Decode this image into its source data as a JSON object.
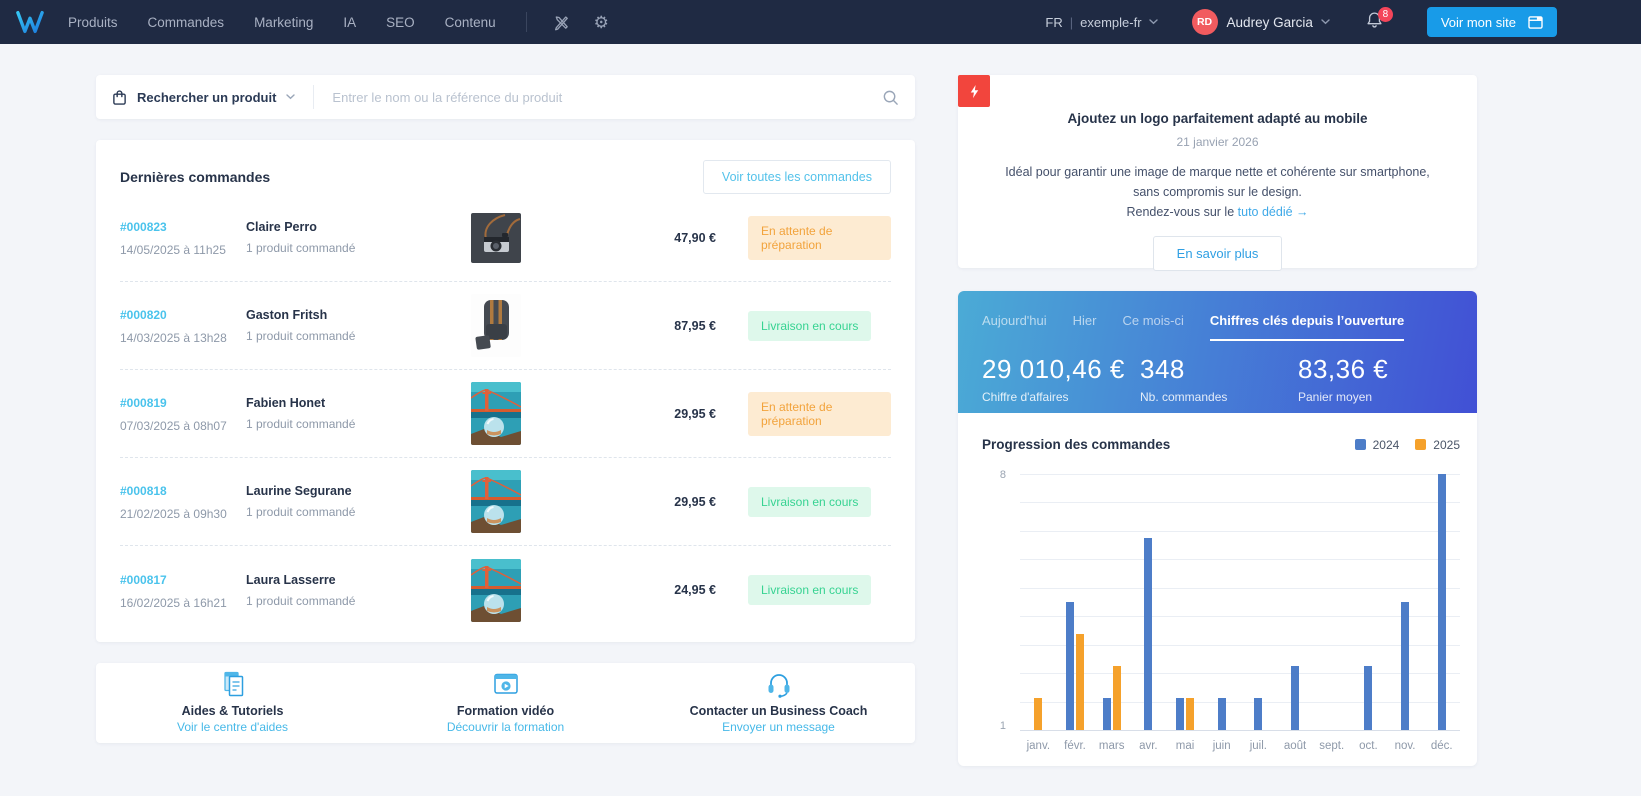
{
  "navbar": {
    "brand": "logo-w",
    "menu": [
      "Produits",
      "Commandes",
      "Marketing",
      "IA",
      "SEO",
      "Contenu"
    ],
    "icons": [
      "design-tools-icon",
      "settings-gear-icon"
    ],
    "locale": "FR",
    "site": "exemple-fr",
    "user_initials": "RD",
    "user_name": "Audrey Garcia",
    "notif_count": "8",
    "visit_site_label": "Voir mon site",
    "bg_color": "#1F2A43",
    "button_color": "#189BE8",
    "avatar_color": "#F15B5F"
  },
  "search": {
    "type_label": "Rechercher un produit",
    "placeholder": "Entrer le nom ou la référence du produit"
  },
  "orders": {
    "title": "Dernières commandes",
    "view_all_label": "Voir toutes les commandes",
    "rows": [
      {
        "id": "#000823",
        "date": "14/05/2025 à 11h25",
        "customer": "Claire Perro",
        "detail": "1 produit commandé",
        "thumb": "camera",
        "price": "47,90 €",
        "status": "En attente de préparation",
        "status_type": "pending"
      },
      {
        "id": "#000820",
        "date": "14/03/2025 à 13h28",
        "customer": "Gaston Fritsh",
        "detail": "1 produit commandé",
        "thumb": "backpack",
        "price": "87,95 €",
        "status": "Livraison en cours",
        "status_type": "shipping"
      },
      {
        "id": "#000819",
        "date": "07/03/2025 à 08h07",
        "customer": "Fabien Honet",
        "detail": "1 produit commandé",
        "thumb": "bridge",
        "price": "29,95 €",
        "status": "En attente de préparation",
        "status_type": "pending"
      },
      {
        "id": "#000818",
        "date": "21/02/2025 à 09h30",
        "customer": "Laurine Segurane",
        "detail": "1 produit commandé",
        "thumb": "bridge",
        "price": "29,95 €",
        "status": "Livraison en cours",
        "status_type": "shipping"
      },
      {
        "id": "#000817",
        "date": "16/02/2025 à 16h21",
        "customer": "Laura Lasserre",
        "detail": "1 produit commandé",
        "thumb": "bridge",
        "price": "24,95 €",
        "status": "Livraison en cours",
        "status_type": "shipping"
      }
    ],
    "status_colors": {
      "pending_bg": "#FDEBD2",
      "pending_text": "#F2A33C",
      "shipping_bg": "#DEF8EB",
      "shipping_text": "#37D392"
    }
  },
  "help": {
    "items": [
      {
        "title": "Aides & Tutoriels",
        "link": "Voir le centre d'aides",
        "icon": "docs-icon"
      },
      {
        "title": "Formation vidéo",
        "link": "Découvrir la formation",
        "icon": "video-icon"
      },
      {
        "title": "Contacter un Business Coach",
        "link": "Envoyer un message",
        "icon": "headset-icon"
      }
    ]
  },
  "notification": {
    "icon": "lightning-icon",
    "icon_bg": "#F2453D",
    "title": "Ajoutez un logo parfaitement adapté au mobile",
    "date": "21 janvier 2026",
    "body_line1": "Idéal pour garantir une image de marque nette et cohérente sur smartphone,",
    "body_line2": "sans compromis sur le design.",
    "body_line3_prefix": "Rendez-vous sur le ",
    "body_link": "tuto dédié →",
    "button": "En savoir plus"
  },
  "stats": {
    "gradient_from": "#4BABD6",
    "gradient_to": "#4150D5",
    "tabs": [
      {
        "label": "Aujourd'hui",
        "active": false
      },
      {
        "label": "Hier",
        "active": false
      },
      {
        "label": "Ce mois-ci",
        "active": false
      },
      {
        "label": "Chiffres clés depuis l’ouverture",
        "active": true
      }
    ],
    "metrics": [
      {
        "value": "29 010,46 €",
        "label": "Chiffre d'affaires"
      },
      {
        "value": "348",
        "label": "Nb. commandes"
      },
      {
        "value": "83,36 €",
        "label": "Panier moyen"
      }
    ]
  },
  "chart_data": {
    "type": "bar",
    "title": "Progression des commandes",
    "categories": [
      "janv.",
      "févr.",
      "mars",
      "avr.",
      "mai",
      "juin",
      "juil.",
      "août",
      "sept.",
      "oct.",
      "nov.",
      "déc."
    ],
    "series": [
      {
        "name": "2024",
        "color": "#4D7DC8",
        "values": [
          0,
          4,
          1,
          6,
          1,
          1,
          1,
          2,
          0,
          2,
          4,
          8
        ]
      },
      {
        "name": "2025",
        "color": "#F5A12B",
        "values": [
          1,
          3,
          2,
          0,
          1,
          0,
          0,
          0,
          0,
          0,
          0,
          0
        ]
      }
    ],
    "ylim": [
      0,
      8
    ],
    "yticks_shown": [
      "8",
      "1"
    ],
    "grid": true,
    "legend_position": "top-right",
    "xlabel": "",
    "ylabel": ""
  }
}
